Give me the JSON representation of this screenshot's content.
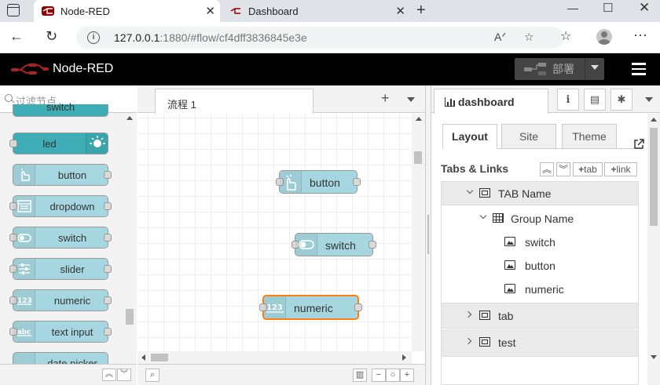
{
  "browser": {
    "tabs": [
      {
        "title": "Node-RED",
        "active": true
      },
      {
        "title": "Dashboard",
        "active": false
      }
    ],
    "url_host": "127.0.0.1",
    "url_path": ":1880/#flow/cf4dff3836845e3e"
  },
  "header": {
    "title": "Node-RED",
    "deploy_label": "部署"
  },
  "palette": {
    "search_placeholder": "过滤节点",
    "partial_top": "switch",
    "nodes": [
      "led",
      "button",
      "dropdown",
      "switch",
      "slider",
      "numeric",
      "text input",
      "date picker"
    ]
  },
  "workspace": {
    "tab_label": "流程 1",
    "flow_nodes": [
      {
        "label": "button",
        "icon": "hand-pointer-icon",
        "selected": false
      },
      {
        "label": "switch",
        "icon": "toggle-icon",
        "selected": false
      },
      {
        "label": "numeric",
        "icon": "numeric-123-icon",
        "selected": true
      }
    ]
  },
  "sidebar": {
    "active_tab": "dashboard",
    "sub_tabs": [
      "Layout",
      "Site",
      "Theme"
    ],
    "tabs_links_header": "Tabs & Links",
    "btn_tab": "tab",
    "btn_link": "link",
    "tree": {
      "tab_name": "TAB Name",
      "group_name": "Group Name",
      "widgets": [
        "switch",
        "button",
        "numeric"
      ],
      "other_tabs": [
        "tab",
        "test"
      ]
    }
  },
  "colors": {
    "node_fill": "#a6d7e1",
    "led_fill": "#3fadb5",
    "selected_outline": "#ff7f0e",
    "header_bg": "#000000"
  }
}
